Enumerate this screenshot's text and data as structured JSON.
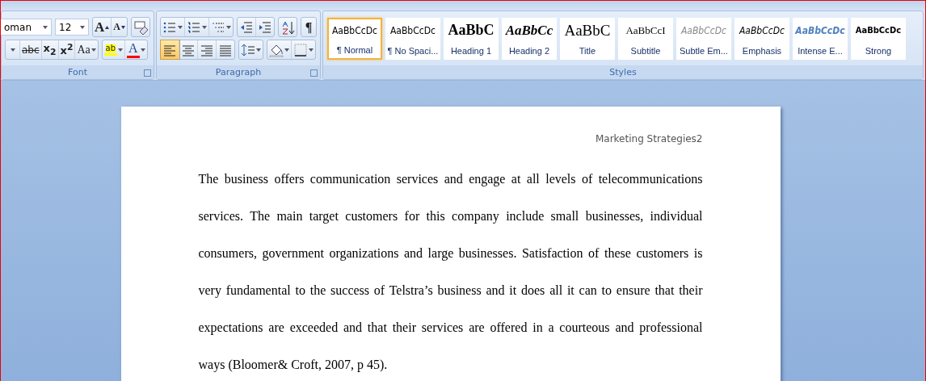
{
  "ribbon": {
    "groups": [
      {
        "label": "Font",
        "toolbar_rows": [
          {
            "controls": [
              {
                "kind": "font-field",
                "value": "oman"
              },
              {
                "kind": "size-field",
                "value": "12"
              },
              {
                "kind": "cluster",
                "items": [
                  {
                    "kind": "grow",
                    "label": "A"
                  },
                  {
                    "kind": "shrink",
                    "label": "A"
                  }
                ]
              },
              {
                "kind": "cluster",
                "items": [
                  {
                    "kind": "clear-format"
                  }
                ]
              }
            ]
          },
          {
            "controls": [
              {
                "kind": "cluster",
                "items": [
                  {
                    "kind": "caret"
                  },
                  {
                    "kind": "strike",
                    "label": "abc"
                  },
                  {
                    "kind": "sub",
                    "label": "x$_{2}$"
                  },
                  {
                    "kind": "sup",
                    "label": "x$^{2}$"
                  },
                  {
                    "kind": "case",
                    "label": "Aa"
                  }
                ]
              },
              {
                "kind": "cluster",
                "items": [
                  {
                    "kind": "highlight",
                    "label": "ab",
                    "color": "#ffff00"
                  },
                  {
                    "kind": "fontcolor",
                    "label": "A",
                    "color": "#ff0000"
                  }
                ]
              }
            ]
          }
        ]
      },
      {
        "label": "Paragraph",
        "toolbar_rows": [
          {
            "controls": [
              {
                "kind": "cluster",
                "items": [
                  {
                    "kind": "bullets"
                  },
                  {
                    "kind": "numbering"
                  },
                  {
                    "kind": "multilevel"
                  }
                ]
              },
              {
                "kind": "cluster",
                "items": [
                  {
                    "kind": "outdent"
                  },
                  {
                    "kind": "indent"
                  }
                ]
              },
              {
                "kind": "cluster",
                "items": [
                  {
                    "kind": "sort"
                  }
                ]
              },
              {
                "kind": "cluster",
                "items": [
                  {
                    "kind": "pilcrow",
                    "label": "¶"
                  }
                ]
              }
            ]
          },
          {
            "controls": [
              {
                "kind": "cluster",
                "items": [
                  {
                    "kind": "align-left",
                    "selected": true
                  },
                  {
                    "kind": "align-center",
                    "selected": false
                  },
                  {
                    "kind": "align-right",
                    "selected": false
                  },
                  {
                    "kind": "justify",
                    "selected": false
                  }
                ]
              },
              {
                "kind": "cluster",
                "items": [
                  {
                    "kind": "line-spacing"
                  }
                ]
              },
              {
                "kind": "cluster",
                "items": [
                  {
                    "kind": "shading"
                  },
                  {
                    "kind": "borders"
                  }
                ]
              }
            ]
          }
        ]
      },
      {
        "label": "Styles",
        "gallery": [
          {
            "preview": "AaBbCcDc",
            "name": "¶ Normal",
            "selected": true
          },
          {
            "preview": "AaBbCcDc",
            "name": "¶ No Spaci...",
            "selected": false
          },
          {
            "preview": "AaBbC",
            "name": "Heading 1",
            "selected": false
          },
          {
            "preview": "AaBbCc",
            "name": "Heading 2",
            "selected": false
          },
          {
            "preview": "AaBbC",
            "name": "Title",
            "selected": false
          },
          {
            "preview": "AaBbCcI",
            "name": "Subtitle",
            "selected": false
          },
          {
            "preview": "AaBbCcDc",
            "name": "Subtle Em...",
            "selected": false
          },
          {
            "preview": "AaBbCcDc",
            "name": "Emphasis",
            "selected": false
          },
          {
            "preview": "AaBbCcDc",
            "name": "Intense E...",
            "selected": false
          },
          {
            "preview": "AaBbCcDc",
            "name": "Strong",
            "selected": false
          }
        ]
      }
    ]
  },
  "document": {
    "header": "Marketing Strategies2",
    "paragraph": "The business offers communication services and engage at all levels of telecommunications services. The main target customers for this company include small businesses, individual consumers, government organizations and large businesses.  Satisfaction of these customers is very fundamental to the success of Telstra’s business and it does all it can to ensure that their expectations are exceeded and that their services are offered in a courteous and professional ways (Bloomer& Croft, 2007, p 45)."
  }
}
